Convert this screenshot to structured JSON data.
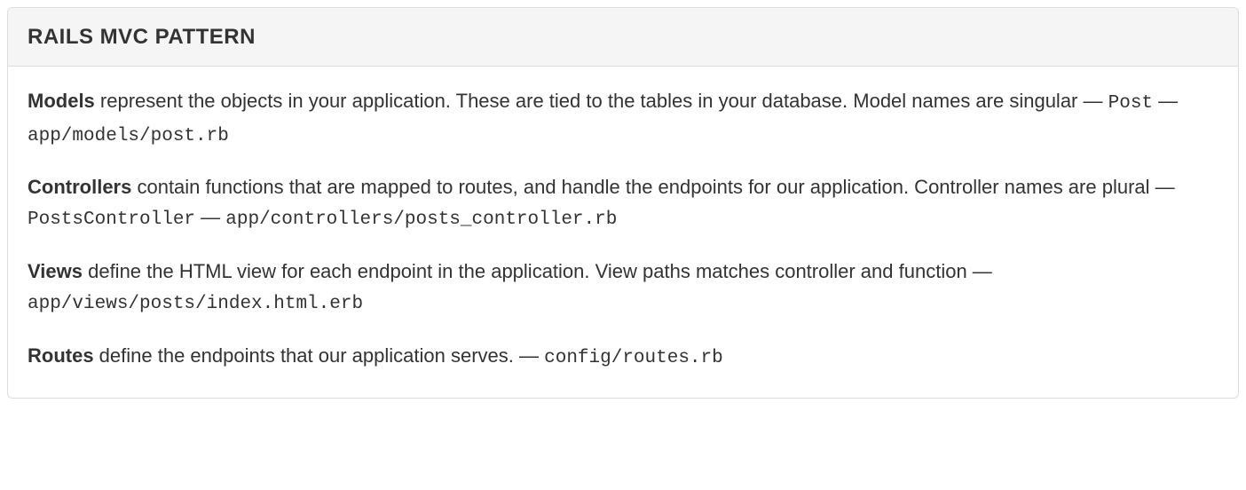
{
  "header": {
    "title": "RAILS MVC PATTERN"
  },
  "sections": {
    "models": {
      "label": "Models",
      "desc": " represent the objects in your application. These are tied to the tables in your database. Model names are singular — ",
      "code1": "Post",
      "sep": " — ",
      "code2": "app/models/post.rb"
    },
    "controllers": {
      "label": "Controllers",
      "desc": " contain functions that are mapped to routes, and handle the endpoints for our application. Controller names are plural — ",
      "code1": "PostsController",
      "sep": " — ",
      "code2": "app/controllers/posts_controller.rb"
    },
    "views": {
      "label": "Views",
      "desc": " define the HTML view for each endpoint in the application. View paths matches controller and function — ",
      "code1": "app/views/posts/index.html.erb"
    },
    "routes": {
      "label": "Routes",
      "desc": " define the endpoints that our application serves. — ",
      "code1": "config/routes.rb"
    }
  }
}
